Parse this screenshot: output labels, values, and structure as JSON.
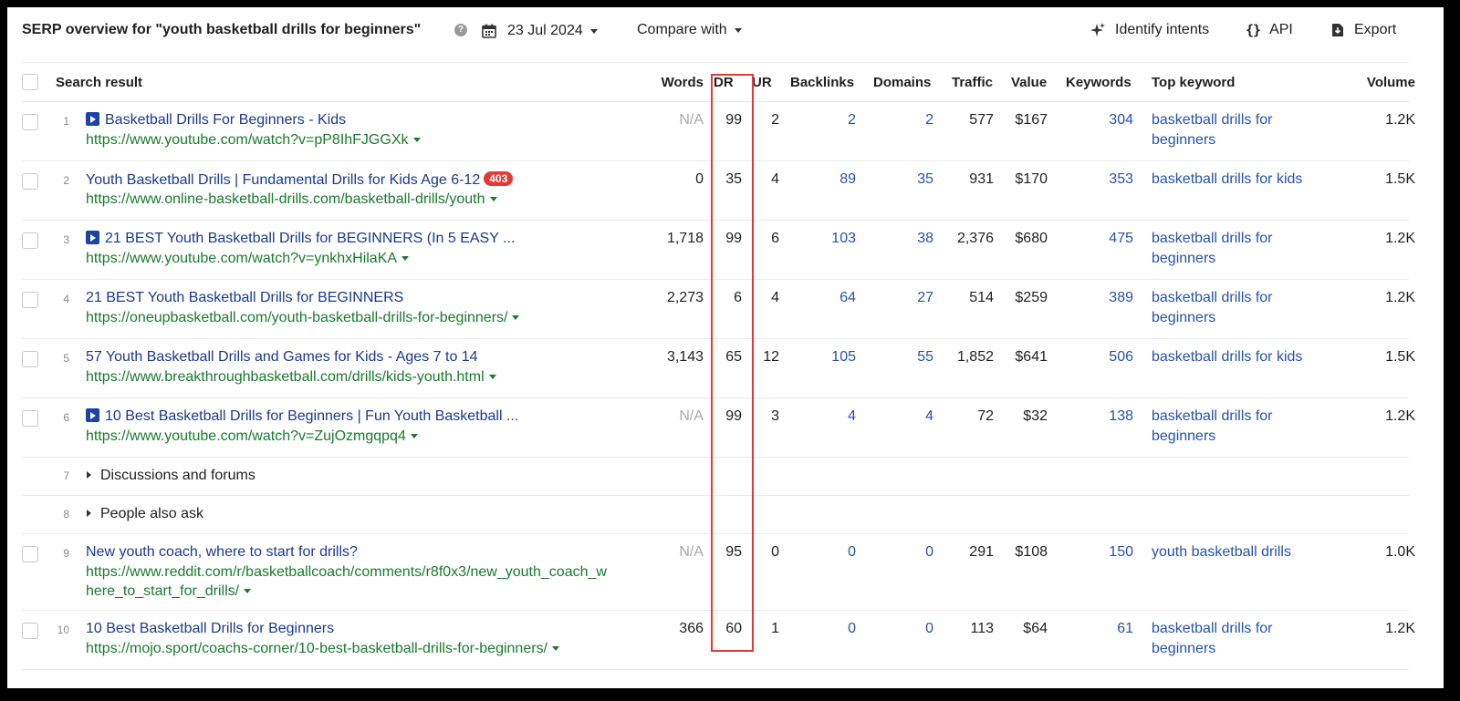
{
  "header": {
    "title": "SERP overview for \"youth basketball drills for beginners\"",
    "date": "23 Jul 2024",
    "compare_label": "Compare with",
    "identify_label": "Identify intents",
    "api_label": "API",
    "export_label": "Export"
  },
  "columns": {
    "search_result": "Search result",
    "words": "Words",
    "dr": "DR",
    "ur": "UR",
    "backlinks": "Backlinks",
    "domains": "Domains",
    "traffic": "Traffic",
    "value": "Value",
    "keywords": "Keywords",
    "top_keyword": "Top keyword",
    "volume": "Volume"
  },
  "rows": [
    {
      "idx": "1",
      "video": true,
      "title": "Basketball Drills For Beginners - Kids",
      "badge": "",
      "url1": "https://www.youtube.com/watch?v=pP8IhFJGGXk",
      "url2": "",
      "words": "N/A",
      "dr": "99",
      "ur": "2",
      "backlinks": "2",
      "domains": "2",
      "traffic": "577",
      "value": "$167",
      "keywords": "304",
      "tk1": "basketball drills for",
      "tk2": "beginners",
      "volume": "1.2K"
    },
    {
      "idx": "2",
      "video": false,
      "title": "Youth Basketball Drills | Fundamental Drills for Kids Age 6-12",
      "badge": "403",
      "url1": "https://www.online-basketball-drills.com/basketball-drills/youth",
      "url2": "",
      "words": "0",
      "dr": "35",
      "ur": "4",
      "backlinks": "89",
      "domains": "35",
      "traffic": "931",
      "value": "$170",
      "keywords": "353",
      "tk1": "basketball drills for kids",
      "tk2": "",
      "volume": "1.5K"
    },
    {
      "idx": "3",
      "video": true,
      "title": "21 BEST Youth Basketball Drills for BEGINNERS (In 5 EASY ...",
      "badge": "",
      "url1": "https://www.youtube.com/watch?v=ynkhxHilaKA",
      "url2": "",
      "words": "1,718",
      "dr": "99",
      "ur": "6",
      "backlinks": "103",
      "domains": "38",
      "traffic": "2,376",
      "value": "$680",
      "keywords": "475",
      "tk1": "basketball drills for",
      "tk2": "beginners",
      "volume": "1.2K"
    },
    {
      "idx": "4",
      "video": false,
      "title": "21 BEST Youth Basketball Drills for BEGINNERS",
      "badge": "",
      "url1": "https://oneupbasketball.com/youth-basketball-drills-for-beginners/",
      "url2": "",
      "words": "2,273",
      "dr": "6",
      "ur": "4",
      "backlinks": "64",
      "domains": "27",
      "traffic": "514",
      "value": "$259",
      "keywords": "389",
      "tk1": "basketball drills for",
      "tk2": "beginners",
      "volume": "1.2K"
    },
    {
      "idx": "5",
      "video": false,
      "title": "57 Youth Basketball Drills and Games for Kids - Ages 7 to 14",
      "badge": "",
      "url1": "https://www.breakthroughbasketball.com/drills/kids-youth.html",
      "url2": "",
      "words": "3,143",
      "dr": "65",
      "ur": "12",
      "backlinks": "105",
      "domains": "55",
      "traffic": "1,852",
      "value": "$641",
      "keywords": "506",
      "tk1": "basketball drills for kids",
      "tk2": "",
      "volume": "1.5K"
    },
    {
      "idx": "6",
      "video": true,
      "title": "10 Best Basketball Drills for Beginners | Fun Youth Basketball ...",
      "badge": "",
      "url1": "https://www.youtube.com/watch?v=ZujOzmgqpq4",
      "url2": "",
      "words": "N/A",
      "dr": "99",
      "ur": "3",
      "backlinks": "4",
      "domains": "4",
      "traffic": "72",
      "value": "$32",
      "keywords": "138",
      "tk1": "basketball drills for",
      "tk2": "beginners",
      "volume": "1.2K"
    }
  ],
  "section7": {
    "idx": "7",
    "label": "Discussions and forums"
  },
  "section8": {
    "idx": "8",
    "label": "People also ask"
  },
  "rows2": [
    {
      "idx": "9",
      "video": false,
      "title": "New youth coach, where to start for drills?",
      "badge": "",
      "url1": "https://www.reddit.com/r/basketballcoach/comments/r8f0x3/new_youth_coach_w",
      "url2": "here_to_start_for_drills/",
      "words": "N/A",
      "dr": "95",
      "ur": "0",
      "backlinks": "0",
      "domains": "0",
      "traffic": "291",
      "value": "$108",
      "keywords": "150",
      "tk1": "youth basketball drills",
      "tk2": "",
      "volume": "1.0K"
    },
    {
      "idx": "10",
      "video": false,
      "title": "10 Best Basketball Drills for Beginners",
      "badge": "",
      "url1": "https://mojo.sport/coachs-corner/10-best-basketball-drills-for-beginners/",
      "url2": "",
      "words": "366",
      "dr": "60",
      "ur": "1",
      "backlinks": "0",
      "domains": "0",
      "traffic": "113",
      "value": "$64",
      "keywords": "61",
      "tk1": "basketball drills for",
      "tk2": "beginners",
      "volume": "1.2K"
    }
  ]
}
